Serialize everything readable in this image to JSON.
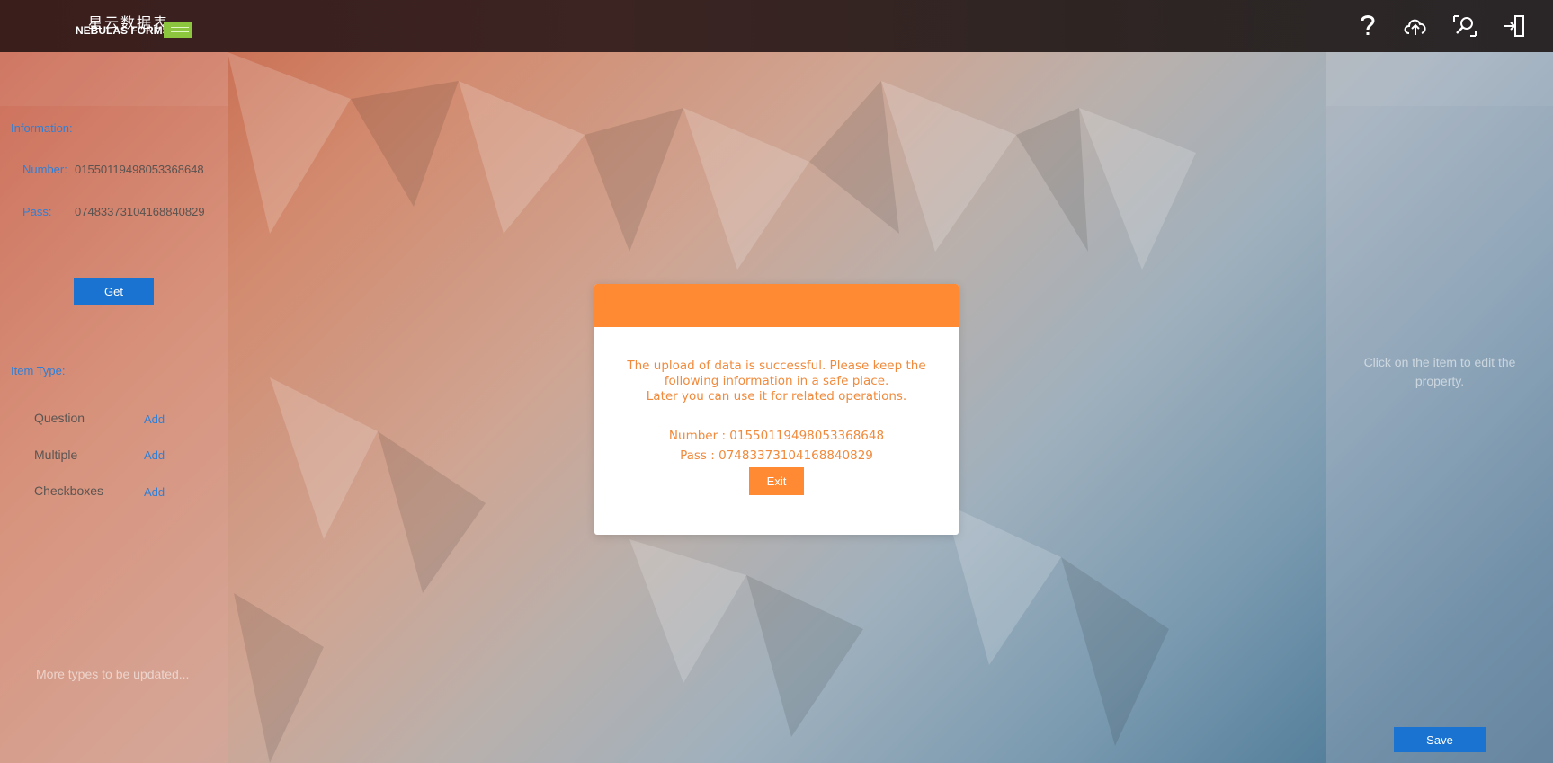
{
  "header": {
    "logo_cn": "星云数据表",
    "logo_en": "NEBULAS FORMS",
    "icons": [
      "help-icon",
      "cloud-upload-icon",
      "search-icon",
      "exit-icon"
    ]
  },
  "left_panel": {
    "info_title": "Information:",
    "number_label": "Number:",
    "number_value": "0155011949805336864​8",
    "pass_label": "Pass:",
    "pass_value": "07483373104168840829",
    "get_label": "Get",
    "item_type_title": "Item Type:",
    "types": [
      {
        "name": "Question",
        "add": "Add"
      },
      {
        "name": "Multiple",
        "add": "Add"
      },
      {
        "name": "Checkboxes",
        "add": "Add"
      }
    ],
    "more_note": "More types to be updated..."
  },
  "right_panel": {
    "hint": "Click on the item to edit the property.",
    "save_label": "Save"
  },
  "modal": {
    "msg_line1": "The upload of data is successful. Please keep the",
    "msg_line2": "following information in a safe place.",
    "msg_line3": "Later you can use it for related operations.",
    "number_line": "Number : 01550119498053368648",
    "pass_line": "Pass : 07483373104168840829",
    "exit_label": "Exit"
  },
  "colors": {
    "accent_orange": "#ff8a33",
    "button_blue": "#1a73d0",
    "label_blue": "#2f7fd6"
  }
}
